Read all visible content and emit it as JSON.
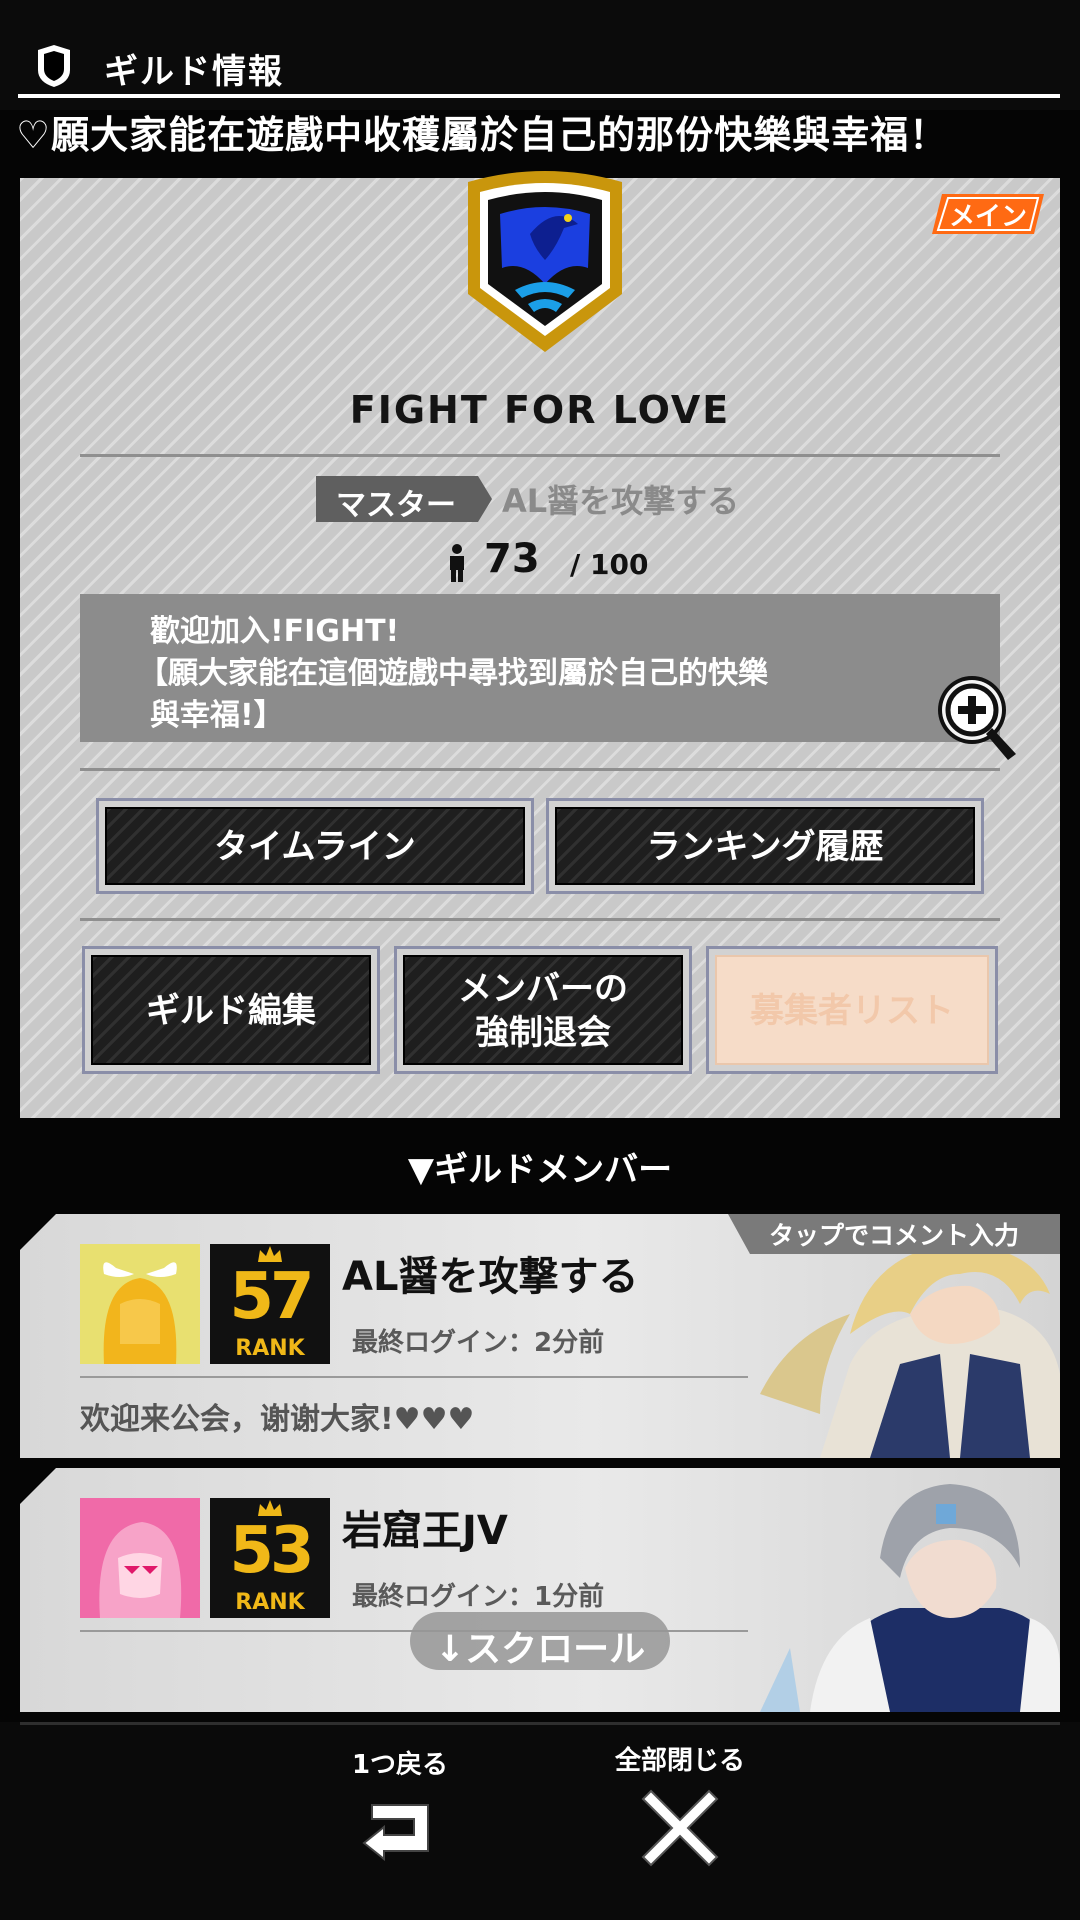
{
  "header": {
    "title": "ギルド情報",
    "marquee": "♡願大家能在遊戲中收穫屬於自己的那份快樂與幸福！"
  },
  "guild": {
    "badge": "メイン",
    "name": "FIGHT FOR LOVE",
    "master_label": "マスター",
    "master_name": "AL醤を攻撃する",
    "member_count": "73",
    "member_max": "/ 100",
    "description_lines": [
      "歡迎加入!FIGHT!",
      "【願大家能在這個遊戲中尋找到屬於自己的快樂",
      "與幸福!】"
    ],
    "buttons": {
      "timeline": "タイムライン",
      "ranking_history": "ランキング履歴",
      "guild_edit": "ギルド編集",
      "kick_member_line1": "メンバーの",
      "kick_member_line2": "強制退会",
      "applicant_list": "募集者リスト"
    }
  },
  "members_section": {
    "title": "▼ギルドメンバー",
    "tap_hint": "タップでコメント入力",
    "members": [
      {
        "name": "AL醤を攻撃する",
        "rank": "57",
        "rank_label": "RANK",
        "last_login": "最終ログイン：2分前",
        "comment": "欢迎来公会，谢谢大家!♥♥♥"
      },
      {
        "name": "岩窟王JV",
        "rank": "53",
        "rank_label": "RANK",
        "last_login": "最終ログイン：1分前",
        "comment": ""
      }
    ]
  },
  "scroll_hint": "↓スクロール",
  "bottom_nav": {
    "back_label": "1つ戻る",
    "close_all_label": "全部閉じる"
  },
  "colors": {
    "accent_orange": "#ff6a13",
    "rank_gold": "#f0b818",
    "emblem_blue": "#1b3fe0"
  }
}
